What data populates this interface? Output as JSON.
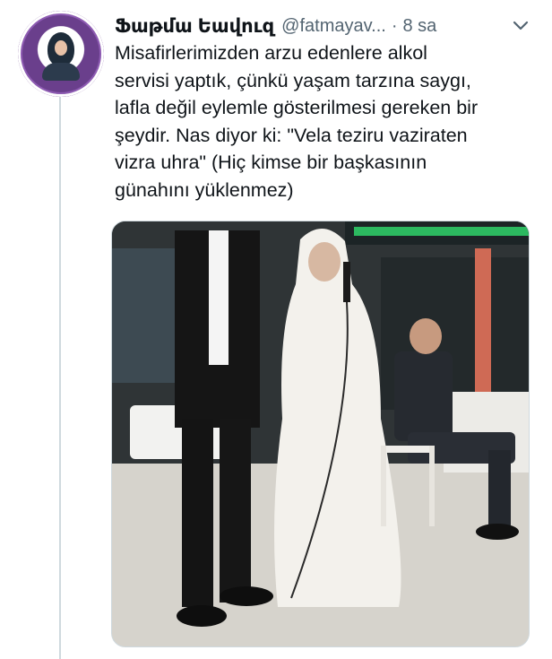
{
  "tweet": {
    "display_name": "Ֆաթմա Եավուզ",
    "handle": "@fatmayav...",
    "separator": "·",
    "time": "8 sa",
    "text": "Misafirlerimizden arzu edenlere alkol\nservisi yaptık, çünkü yaşam tarzına saygı,\nlafla değil eylemle gösterilmesi gereken bir\nşeydir. Nas diyor ki: \"Vela teziru vaziraten\nvizra uhra\" (Hiç kimse bir başkasının\ngünahını yüklenmez)"
  },
  "icons": {
    "avatar": "profile-photo",
    "more": "chevron-down-icon"
  },
  "colors": {
    "text": "#0f1419",
    "secondary": "#536471",
    "avatar_ring": "#6a3f8c"
  }
}
